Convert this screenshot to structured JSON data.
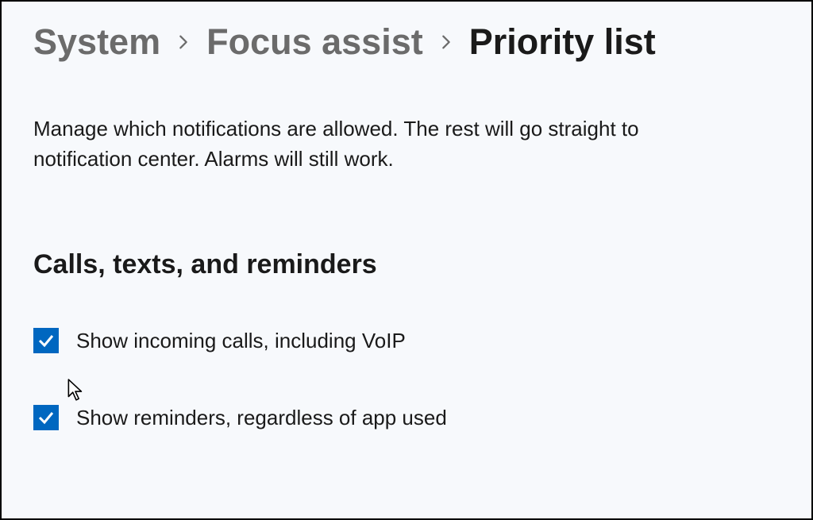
{
  "breadcrumb": {
    "items": [
      {
        "label": "System"
      },
      {
        "label": "Focus assist"
      },
      {
        "label": "Priority list"
      }
    ]
  },
  "description": "Manage which notifications are allowed. The rest will go straight to notification center. Alarms will still work.",
  "section": {
    "heading": "Calls, texts, and reminders",
    "options": [
      {
        "label": "Show incoming calls, including VoIP",
        "checked": true
      },
      {
        "label": "Show reminders, regardless of app used",
        "checked": true
      }
    ]
  },
  "colors": {
    "accent": "#0067c0"
  }
}
